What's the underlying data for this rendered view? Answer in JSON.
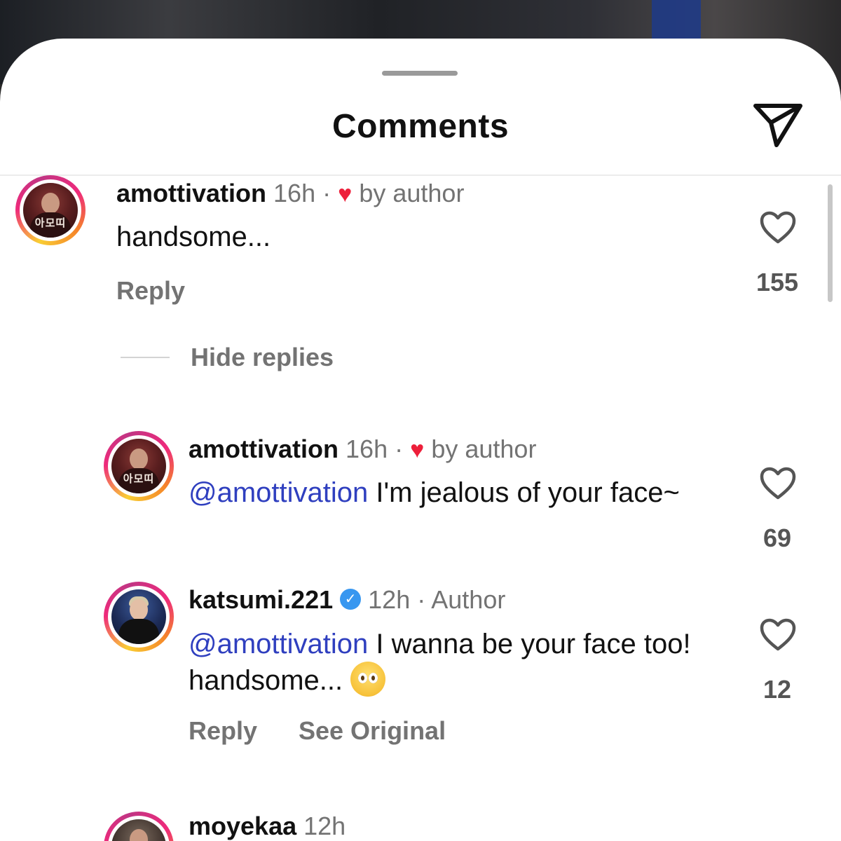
{
  "header": {
    "title": "Comments"
  },
  "comments": [
    {
      "username": "amottivation",
      "time": "16h",
      "separator": "·",
      "liked_label": "by author",
      "mention": "",
      "text": "handsome...",
      "reply_label": "Reply",
      "likes": "155",
      "avatar_label": "아모띠"
    },
    {
      "username": "amottivation",
      "time": "16h",
      "separator": "·",
      "liked_label": "by author",
      "mention": "@amottivation",
      "text": " I'm jealous of your face~",
      "likes": "69",
      "avatar_label": "아모띠"
    },
    {
      "username": "katsumi.221",
      "time": "12h",
      "separator": "·",
      "author_label": "Author",
      "mention": "@amottivation",
      "text": " I wanna be your face too! handsome... ",
      "reply_label": "Reply",
      "see_original_label": "See Original",
      "likes": "12"
    },
    {
      "username": "moyekaa",
      "time": "12h"
    }
  ],
  "thread": {
    "hide_replies_label": "Hide replies"
  },
  "icons": {
    "share": "paper-plane-icon",
    "like": "heart-outline-icon",
    "liked_by_author": "heart-filled-icon",
    "verified": "verified-badge-icon",
    "emoji": "pleading-face-emoji"
  },
  "colors": {
    "mention": "#2f3fbf",
    "heart": "#ed1f3a",
    "verified": "#3897f0",
    "meta": "#737373"
  }
}
